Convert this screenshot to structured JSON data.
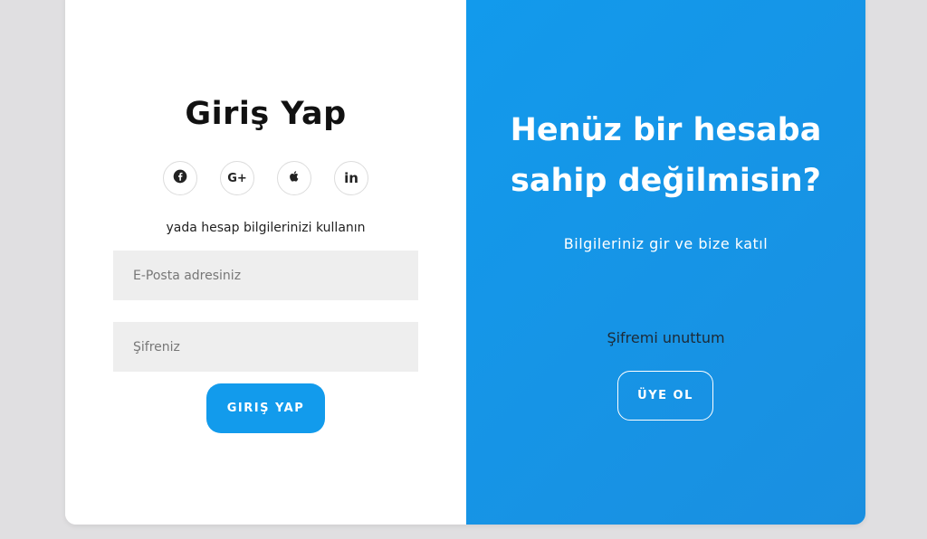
{
  "login": {
    "title": "Giriş Yap",
    "socials": [
      {
        "icon": "facebook-icon"
      },
      {
        "icon": "google-plus-icon",
        "glyph": "G+"
      },
      {
        "icon": "apple-icon"
      },
      {
        "icon": "linkedin-icon",
        "glyph": "in"
      }
    ],
    "subtitle": "yada hesap bilgilerinizi kullanın",
    "email_placeholder": "E-Posta adresiniz",
    "password_placeholder": "Şifreniz",
    "button_label": "GIRIŞ YAP"
  },
  "signup": {
    "title_line1": "Henüz bir hesaba",
    "title_line2": "sahip değilmisin?",
    "subtitle": "Bilgileriniz gir ve bize katıl",
    "forgot_label": "Şifremi unuttum",
    "button_label": "ÜYE OL"
  },
  "colors": {
    "accent": "#129bec",
    "background": "#e0dfe1",
    "input_bg": "#eeeeee"
  }
}
